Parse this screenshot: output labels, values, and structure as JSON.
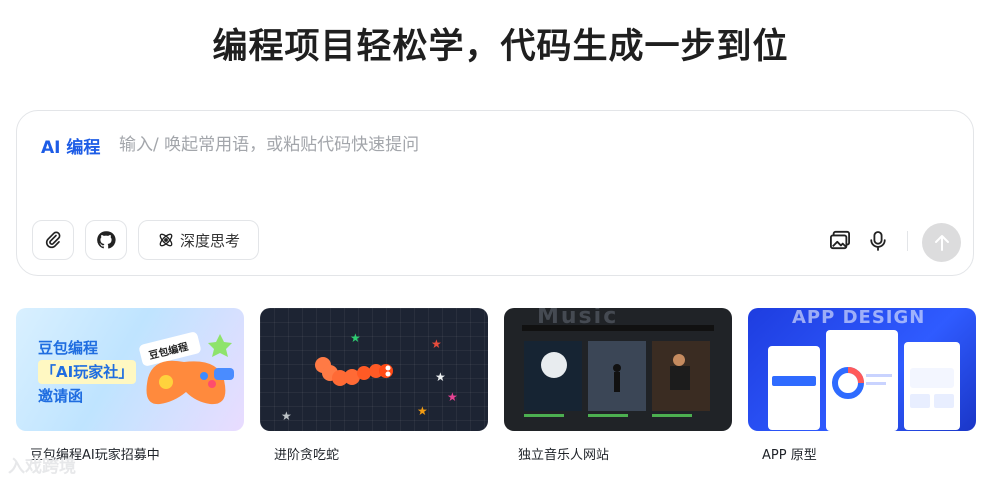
{
  "headline": "编程项目轻松学，代码生成一步到位",
  "composer": {
    "mode_label": "AI 编程",
    "placeholder": "输入/ 唤起常用语，或粘贴代码快速提问",
    "deep_thinking_label": "深度思考",
    "icons": [
      "paperclip-icon",
      "github-icon",
      "atom-icon",
      "image-icon",
      "microphone-icon",
      "arrow-up-icon"
    ]
  },
  "cards": [
    {
      "title": "豆包编程AI玩家招募中",
      "thumb_lines": [
        "豆包编程",
        "「AI玩家社」",
        "邀请函"
      ],
      "thumb_badge": "豆包编程"
    },
    {
      "title": "进阶贪吃蛇"
    },
    {
      "title": "独立音乐人网站",
      "thumb_heading": "Music"
    },
    {
      "title": "APP 原型",
      "thumb_heading": "APP DESIGN"
    }
  ],
  "watermark": "入戏跨境",
  "colors": {
    "accent": "#1d5ce6",
    "send_disabled": "#dcdcdd"
  }
}
